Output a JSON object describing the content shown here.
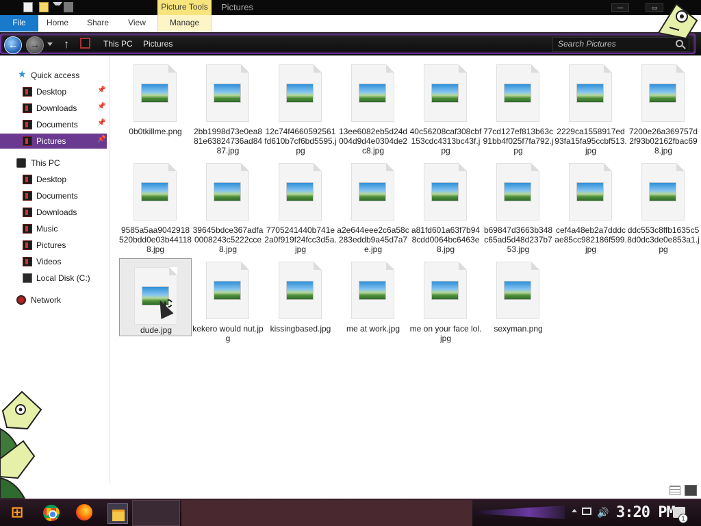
{
  "window": {
    "title": "Pictures",
    "contextual_group": "Picture Tools",
    "minimize_glyph": "—",
    "maximize_glyph": "▭"
  },
  "ribbon": {
    "tabs": [
      {
        "label": "File"
      },
      {
        "label": "Home"
      },
      {
        "label": "Share"
      },
      {
        "label": "View"
      },
      {
        "label": "Manage"
      }
    ]
  },
  "navbar": {
    "back_glyph": "←",
    "forward_glyph": "→",
    "up_glyph": "↑",
    "breadcrumb": [
      "This PC",
      "Pictures"
    ],
    "search_placeholder": "Search Pictures"
  },
  "sidebar": {
    "quick_access": {
      "label": "Quick access",
      "icon": "star-icon"
    },
    "pinned": [
      {
        "label": "Desktop",
        "icon": "desktop-icon",
        "pinned": true
      },
      {
        "label": "Downloads",
        "icon": "downloads-icon",
        "pinned": true
      },
      {
        "label": "Documents",
        "icon": "documents-icon",
        "pinned": true
      },
      {
        "label": "Pictures",
        "icon": "pictures-icon",
        "pinned": true,
        "selected": true
      }
    ],
    "this_pc": {
      "label": "This PC",
      "icon": "computer-icon"
    },
    "pc_items": [
      {
        "label": "Desktop",
        "icon": "desktop-icon"
      },
      {
        "label": "Documents",
        "icon": "documents-icon"
      },
      {
        "label": "Downloads",
        "icon": "downloads-icon"
      },
      {
        "label": "Music",
        "icon": "music-icon"
      },
      {
        "label": "Pictures",
        "icon": "pictures-icon"
      },
      {
        "label": "Videos",
        "icon": "videos-icon"
      },
      {
        "label": "Local Disk (C:)",
        "icon": "disk-icon"
      }
    ],
    "network": {
      "label": "Network",
      "icon": "network-icon"
    },
    "pin_glyph": "📌"
  },
  "files": [
    {
      "name": "0b0tkillme.png"
    },
    {
      "name": "2bb1998d73e0ea881e63824736ad8487.jpg"
    },
    {
      "name": "12c74f4660592561fd610b7cf6bd5595.jpg"
    },
    {
      "name": "13ee6082eb5d24d004d9d4e0304de2c8.jpg"
    },
    {
      "name": "40c56208caf308cbf153cdc4313bc43f.jpg"
    },
    {
      "name": "77cd127ef813b63c91bb4f025f7fa792.jpg"
    },
    {
      "name": "2229ca1558917ed93fa15fa95ccbf513.jpg"
    },
    {
      "name": "7200e26a369757d2f93b02162fbac698.jpg"
    },
    {
      "name": "9585a5aa9042918520bdd0e03b441188.jpg"
    },
    {
      "name": "39645bdce367adfa0008243c5222cce8.jpg"
    },
    {
      "name": "7705241440b741e2a0f919f24fcc3d5a.jpg"
    },
    {
      "name": "a2e644eee2c6a58c283eddb9a45d7a7e.jpg"
    },
    {
      "name": "a81fd601a63f7b948cdd0064bc6463e8.jpg"
    },
    {
      "name": "b69847d3663b348c65ad5d48d237b753.jpg"
    },
    {
      "name": "cef4a48eb2a7dddcae85cc982186f599.jpg"
    },
    {
      "name": "ddc553c8ffb1635c58d0dc3de0e853a1.jpg"
    },
    {
      "name": "dude.jpg",
      "selected": true
    },
    {
      "name": "kekero would nut.jpg"
    },
    {
      "name": "kissingbased.jpg"
    },
    {
      "name": "me at work.jpg"
    },
    {
      "name": "me on your face lol.jpg"
    },
    {
      "name": "sexyman.png"
    }
  ],
  "taskbar": {
    "start_glyph": "⊞",
    "apps": [
      "chrome-icon",
      "firefox-icon",
      "file-explorer-icon"
    ],
    "volume_glyph": "🔊",
    "clock": "3:20 PM",
    "notification_count": "1"
  },
  "colors": {
    "accent": "#6a3a91",
    "file_tab": "#1979ca",
    "picture_tools": "#f7e47c"
  }
}
